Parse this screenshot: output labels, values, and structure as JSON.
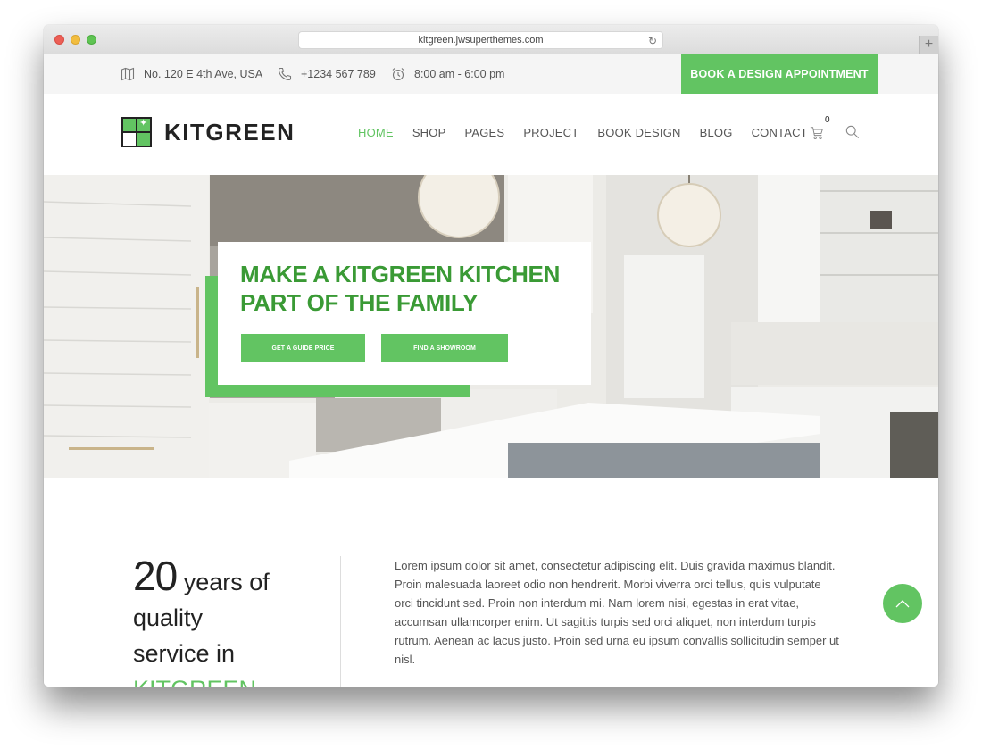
{
  "browser": {
    "url": "kitgreen.jwsuperthemes.com",
    "reload_icon": "reload-icon",
    "new_tab_icon": "plus-icon"
  },
  "topbar": {
    "address": {
      "icon": "map-icon",
      "text": "No. 120 E 4th Ave, USA"
    },
    "phone": {
      "icon": "phone-icon",
      "text": "+1234 567 789"
    },
    "hours": {
      "icon": "clock-icon",
      "text": "8:00 am - 6:00 pm"
    },
    "cta_label": "BOOK A DESIGN APPOINTMENT"
  },
  "header": {
    "logo_text": "KITGREEN",
    "nav": [
      {
        "label": "HOME",
        "active": true
      },
      {
        "label": "SHOP",
        "active": false
      },
      {
        "label": "PAGES",
        "active": false
      },
      {
        "label": "PROJECT",
        "active": false
      },
      {
        "label": "BOOK DESIGN",
        "active": false
      },
      {
        "label": "BLOG",
        "active": false
      },
      {
        "label": "CONTACT",
        "active": false
      }
    ],
    "cart_count": "0",
    "cart_icon": "cart-icon",
    "search_icon": "search-icon"
  },
  "hero": {
    "title_line1": "MAKE A KITGREEN KITCHEN",
    "title_line2": "PART OF THE FAMILY",
    "button1": "GET A GUIDE PRICE",
    "button2": "FIND A SHOWROOM"
  },
  "about": {
    "years_number": "20",
    "years_text": "years of",
    "line2": "quality",
    "line3": "service in",
    "line4": "KITGREEN",
    "paragraph": "Lorem ipsum dolor sit amet, consectetur adipiscing elit. Duis gravida maximus blandit. Proin malesuada laoreet odio non hendrerit. Morbi viverra orci tellus, quis vulputate orci tincidunt sed. Proin non interdum mi. Nam lorem nisi, egestas in erat vitae, accumsan ullamcorper enim. Ut sagittis turpis sed orci aliquet, non interdum turpis rutrum. Aenean ac lacus justo. Proin sed urna eu ipsum convallis sollicitudin semper ut nisl."
  },
  "colors": {
    "accent": "#62c462",
    "title_green": "#3a9a35",
    "text": "#555555"
  },
  "scroll_top_icon": "chevron-up-icon"
}
